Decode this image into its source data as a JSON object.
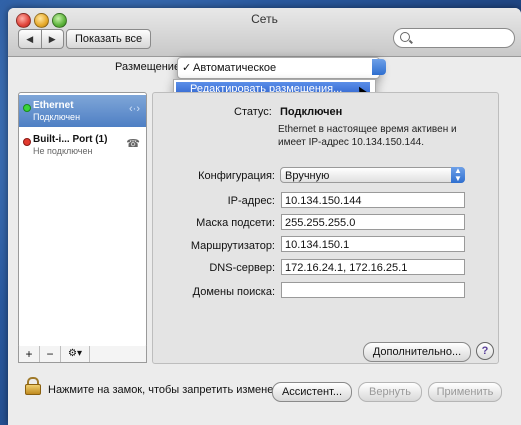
{
  "window": {
    "title": "Сеть"
  },
  "toolbar": {
    "back": "◀",
    "forward": "▶",
    "show_all": "Показать все",
    "search_placeholder": ""
  },
  "location": {
    "label": "Размещение:",
    "check": "✓",
    "selected": "Автоматическое",
    "menu_item": "Редактировать размещения..."
  },
  "sidebar": {
    "items": [
      {
        "name": "Ethernet",
        "status": "Подключен",
        "indicator": "green",
        "icon": "ethernet-arrows-icon"
      },
      {
        "name": "Built-i... Port (1)",
        "status": "Не подключен",
        "indicator": "red",
        "icon": "phone-modem-icon"
      }
    ],
    "add": "+",
    "remove": "−",
    "gear": "⚙▾"
  },
  "details": {
    "status_label": "Статус:",
    "status_value": "Подключен",
    "status_desc": "Ethernet в настоящее время активен и имеет IP-адрес 10.134.150.144.",
    "config_label": "Конфигурация:",
    "config_value": "Вручную",
    "ip_label": "IP-адрес:",
    "ip_value": "10.134.150.144",
    "mask_label": "Маска подсети:",
    "mask_value": "255.255.255.0",
    "router_label": "Маршрутизатор:",
    "router_value": "10.134.150.1",
    "dns_label": "DNS-сервер:",
    "dns_value": "172.16.24.1, 172.16.25.1",
    "search_domains_label": "Домены поиска:",
    "search_domains_value": "",
    "advanced": "Дополнительно...",
    "help": "?"
  },
  "bottom": {
    "lock_text": "Нажмите на замок, чтобы запретить изменения.",
    "assistant": "Ассистент...",
    "revert": "Вернуть",
    "apply": "Применить"
  },
  "colors": {
    "selected_item": "#4e7fc4",
    "menu_highlight": "#2d62cc",
    "status_green": "#3ad43a",
    "status_red": "#e23a2e"
  }
}
